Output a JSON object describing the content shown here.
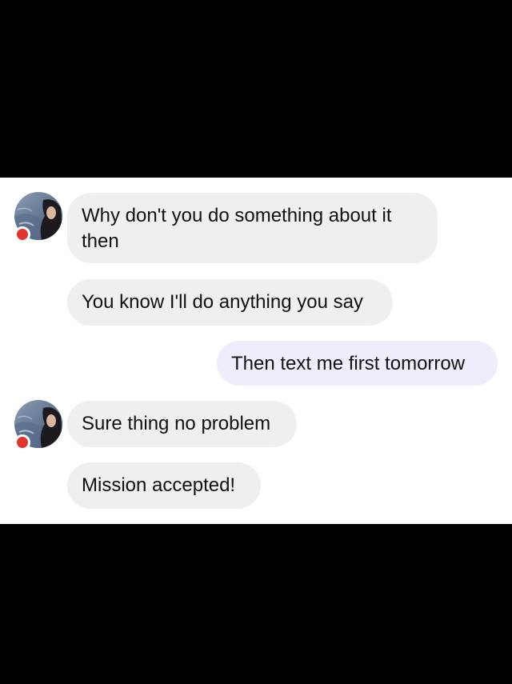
{
  "conversation": {
    "messages": [
      {
        "direction": "incoming",
        "text": "Why don't you do something about it then"
      },
      {
        "direction": "incoming",
        "text": "You know I'll do anything you say"
      },
      {
        "direction": "outgoing",
        "text": "Then text me first tomorrow"
      },
      {
        "direction": "incoming",
        "text": "Sure thing no problem"
      },
      {
        "direction": "incoming",
        "text": "Mission accepted!"
      }
    ]
  },
  "contact": {
    "avatar_icon": "profile-photo",
    "status_icon": "online-status-dot",
    "status_color": "#e0342e"
  },
  "colors": {
    "incoming_bubble": "#efeff2",
    "outgoing_bubble": "#efecfb",
    "text": "#111111",
    "background": "#ffffff",
    "letterbox": "#000000"
  }
}
